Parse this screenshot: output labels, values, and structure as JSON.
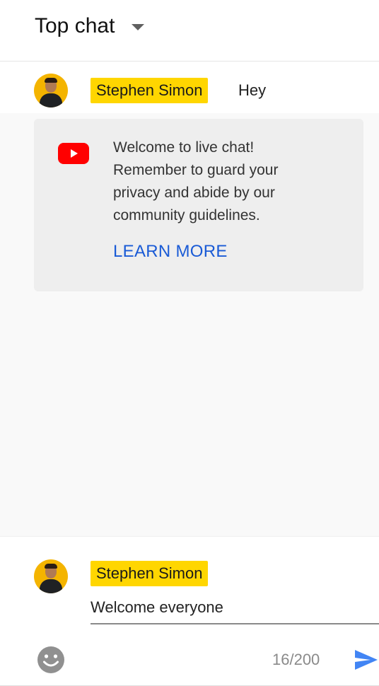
{
  "header": {
    "title": "Top chat",
    "dropdown_icon": "caret-down-icon"
  },
  "pinned_message": {
    "author": "Stephen Simon",
    "text": "Hey",
    "avatar_icon": "user-avatar",
    "author_chip_color": "#ffd600"
  },
  "welcome_card": {
    "icon": "youtube-icon",
    "message": "Welcome to live chat!\nRemember to guard your\nprivacy and abide by our\ncommunity guidelines.",
    "link_label": "LEARN MORE",
    "link_color": "#1a5bd6",
    "brand_color": "#ff0000"
  },
  "composer": {
    "author": "Stephen Simon",
    "avatar_icon": "user-avatar",
    "input_value": "Welcome everyone",
    "counter": "16/200",
    "emoji_icon": "emoji-icon",
    "send_icon": "send-icon",
    "send_color": "#4285f4"
  }
}
